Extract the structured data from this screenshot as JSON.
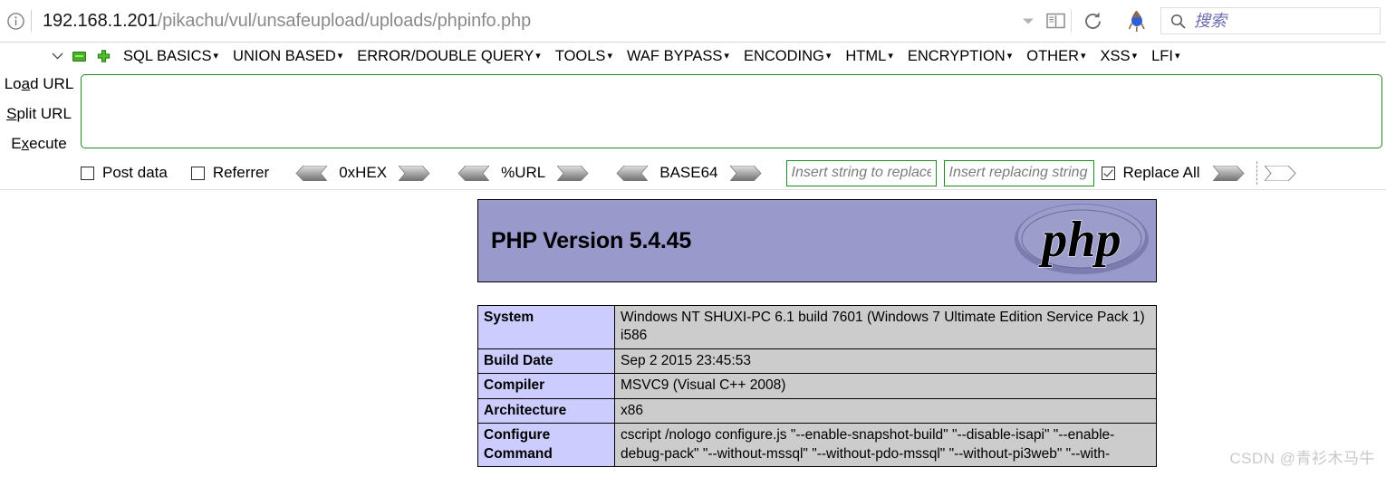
{
  "browser": {
    "info_icon": "info-circle-icon",
    "url_host": "192.168.1.201",
    "url_path": "/pikachu/vul/unsafeupload/uploads/phpinfo.php",
    "url_full": "192.168.1.201/pikachu/vul/unsafeupload/uploads/phpinfo.php",
    "chevron_icon": "chevron-down-icon",
    "reader_icon": "reader-view-icon",
    "reload_icon": "reload-icon",
    "extension_icon": "hackbar-extension-icon",
    "search_icon": "search-icon",
    "search_placeholder": "搜索",
    "search_value": ""
  },
  "hackbar": {
    "toggle_icon": "chevron-down-icon",
    "minus_icon": "green-minus-icon",
    "plus_icon": "green-plus-icon",
    "menus": [
      {
        "label": "SQL BASICS",
        "caret": "▾"
      },
      {
        "label": "UNION BASED",
        "caret": "▾"
      },
      {
        "label": "ERROR/DOUBLE QUERY",
        "caret": "▾"
      },
      {
        "label": "TOOLS",
        "caret": "▾"
      },
      {
        "label": "WAF BYPASS",
        "caret": "▾"
      },
      {
        "label": "ENCODING",
        "caret": "▾"
      },
      {
        "label": "HTML",
        "caret": "▾"
      },
      {
        "label": "ENCRYPTION",
        "caret": "▾"
      },
      {
        "label": "OTHER",
        "caret": "▾"
      },
      {
        "label": "XSS",
        "caret": "▾"
      },
      {
        "label": "LFI",
        "caret": "▾"
      }
    ],
    "side_buttons": [
      {
        "pre": "Lo",
        "key": "a",
        "post": "d URL"
      },
      {
        "pre": "",
        "key": "S",
        "post": "plit URL"
      },
      {
        "pre": "E",
        "key": "x",
        "post": "ecute"
      }
    ],
    "url_textarea_value": "",
    "options": {
      "post_data_label": "Post data",
      "post_data_checked": false,
      "referrer_label": "Referrer",
      "referrer_checked": false,
      "hex_label": "0xHEX",
      "url_label": "%URL",
      "base64_label": "BASE64",
      "replace_search_placeholder": "Insert string to replace",
      "replace_search_value": "",
      "replace_with_placeholder": "Insert replacing string",
      "replace_with_value": "",
      "replace_all_label": "Replace All",
      "replace_all_checked": true
    }
  },
  "phpinfo": {
    "version_title": "PHP Version 5.4.45",
    "logo_text": "php",
    "rows": [
      {
        "key": "System",
        "value": "Windows NT SHUXI-PC 6.1 build 7601 (Windows 7 Ultimate Edition Service Pack 1) i586"
      },
      {
        "key": "Build Date",
        "value": "Sep 2 2015 23:45:53"
      },
      {
        "key": "Compiler",
        "value": "MSVC9 (Visual C++ 2008)"
      },
      {
        "key": "Architecture",
        "value": "x86"
      },
      {
        "key": "Configure Command",
        "value": "cscript /nologo configure.js \"--enable-snapshot-build\" \"--disable-isapi\" \"--enable-debug-pack\" \"--without-mssql\" \"--without-pdo-mssql\" \"--without-pi3web\" \"--with-"
      }
    ]
  },
  "watermark": "CSDN @青衫木马牛"
}
